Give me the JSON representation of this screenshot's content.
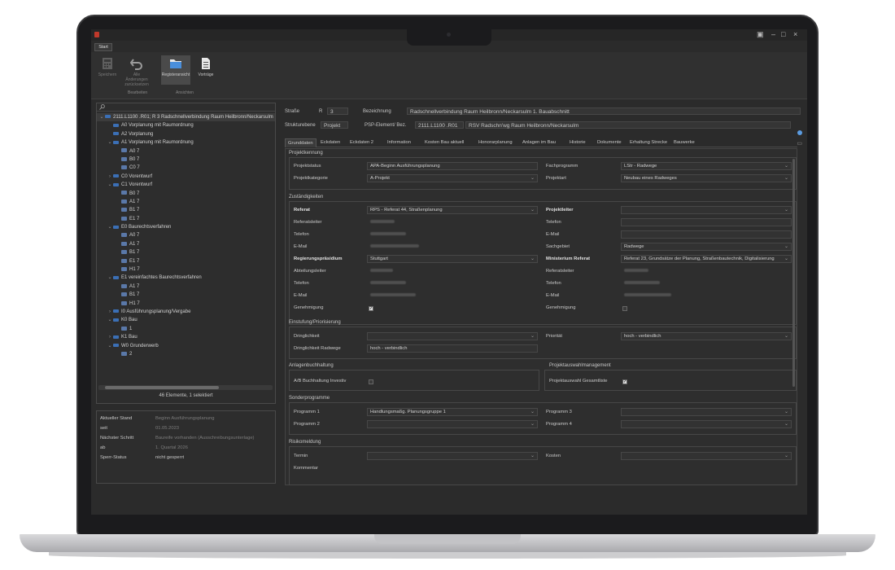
{
  "ribbon": {
    "tab": "Start",
    "buttons": [
      {
        "label": "Speichern",
        "icon": "calculator-icon"
      },
      {
        "label": "Alle Änderungen zurücksetzen",
        "icon": "undo-icon"
      },
      {
        "label": "Registeransicht",
        "icon": "folder-icon"
      },
      {
        "label": "Vorträge",
        "icon": "document-icon"
      }
    ],
    "groups": [
      "Bearbeiten",
      "Ansichten"
    ]
  },
  "tree": {
    "items": [
      {
        "label": "2111.L1100 .R01; R 3 Radschnellverbindung Raum Heilbronn/Neckarsulm",
        "toggle": "⌄",
        "level": 0
      },
      {
        "label": "A0 Vorplanung mit Raumordnung",
        "toggle": "",
        "level": 1
      },
      {
        "label": "A2 Vorplanung",
        "toggle": "",
        "level": 1
      },
      {
        "label": "A1 Vorplanung mit Raumordnung",
        "toggle": "⌄",
        "level": 1
      },
      {
        "label": "A0 7",
        "toggle": "",
        "level": 2
      },
      {
        "label": "B0 7",
        "toggle": "",
        "level": 2
      },
      {
        "label": "C0 7",
        "toggle": "",
        "level": 2
      },
      {
        "label": "C0 Vorentwurf",
        "toggle": "›",
        "level": 1
      },
      {
        "label": "C1 Vorentwurf",
        "toggle": "⌄",
        "level": 1
      },
      {
        "label": "B0 7",
        "toggle": "",
        "level": 2
      },
      {
        "label": "A1 7",
        "toggle": "",
        "level": 2
      },
      {
        "label": "B1 7",
        "toggle": "",
        "level": 2
      },
      {
        "label": "E1 7",
        "toggle": "",
        "level": 2
      },
      {
        "label": "E0 Baurechtsverfahren",
        "toggle": "⌄",
        "level": 1
      },
      {
        "label": "A0 7",
        "toggle": "",
        "level": 2
      },
      {
        "label": "A1 7",
        "toggle": "",
        "level": 2
      },
      {
        "label": "B1 7",
        "toggle": "",
        "level": 2
      },
      {
        "label": "E1 7",
        "toggle": "",
        "level": 2
      },
      {
        "label": "H1 7",
        "toggle": "",
        "level": 2
      },
      {
        "label": "E1 vereinfachtes Baurechtsverfahren",
        "toggle": "⌄",
        "level": 1
      },
      {
        "label": "A1 7",
        "toggle": "",
        "level": 2
      },
      {
        "label": "B1 7",
        "toggle": "",
        "level": 2
      },
      {
        "label": "H1 7",
        "toggle": "",
        "level": 2
      },
      {
        "label": "I0 Ausführungsplanung/Vergabe",
        "toggle": "›",
        "level": 1
      },
      {
        "label": "K0 Bau",
        "toggle": "⌄",
        "level": 1
      },
      {
        "label": "1",
        "toggle": "",
        "level": 2
      },
      {
        "label": "K1 Bau",
        "toggle": "›",
        "level": 1
      },
      {
        "label": "W0 Grunderwerb",
        "toggle": "⌄",
        "level": 1
      },
      {
        "label": "2",
        "toggle": "",
        "level": 2
      }
    ],
    "status": "46 Elemente, 1 selektiert"
  },
  "info": {
    "rows": [
      {
        "key": "Aktueller Stand",
        "value": "Beginn Ausführungsplanung"
      },
      {
        "key": "seit",
        "value": "01.05.2023"
      },
      {
        "key": "Nächster Schritt",
        "value": "Baureife vorhanden (Ausschreibungsunterlage)"
      },
      {
        "key": "ab",
        "value": "1. Quartal 2026"
      },
      {
        "key": "Sperr-Status",
        "value": "nicht gesperrt"
      }
    ]
  },
  "header": {
    "strasse_label": "Straße",
    "strasse_r": "R",
    "strasse_num": "3",
    "bezeichnung_label": "Bezeichnung",
    "bezeichnung_value": "Radschnellverbindung Raum Heilbronn/Neckarsulm 1. Bauabschnitt",
    "strukturebene_label": "Strukturebene",
    "strukturebene_value": "Projekt",
    "psp_label": "PSP-Element/ Bez.",
    "psp_value": "2111.L1100 .R01",
    "psp_desc": "RSV Radschn'wg Raum Heilbronn/Neckarsulm"
  },
  "tabs": [
    "Grunddaten",
    "Eckdaten",
    "Eckdaten 2",
    "Information",
    "Kosten Bau aktuell",
    "Honorarplanung",
    "Anlagen im Bau",
    "Historie",
    "Dokumente",
    "Erhaltung Strecke",
    "Bauwerke"
  ],
  "form": {
    "projektkennung": {
      "title": "Projektkennung",
      "projektstatus_label": "Projektstatus",
      "projektstatus": "APA-Beginn Ausführungsplanung",
      "fachprogramm_label": "Fachprogramm",
      "fachprogramm": "LStr - Radwege",
      "projektkategorie_label": "Projektkategorie",
      "projektkategorie": "A-Projekt",
      "projektart_label": "Projektart",
      "projektart": "Neubau eines Radweges"
    },
    "zustaendigkeiten": {
      "title": "Zuständigkeiten",
      "referat_label": "Referat",
      "referat": "RPS - Referat 44, Straßenplanung",
      "projektleiter_label": "Projektleiter",
      "referatsleiter_label": "Referatsleiter",
      "telefon_label": "Telefon",
      "email_label": "E-Mail",
      "sachgebiet_label": "Sachgebiet",
      "sachgebiet": "Radwege",
      "rp_label": "Regierungspräsidium",
      "rp": "Stuttgart",
      "ministerium_label": "Ministerium Referat",
      "ministerium": "Referat 23, Grundsätze der Planung, Straßenbautechnik, Digitalisierung",
      "abteilungsleiter_label": "Abteilungsleiter",
      "genehmigung_label": "Genehmigung"
    },
    "einstufung": {
      "title": "Einstufung/Priorisierung",
      "dringlichkeit_label": "Dringlichkeit",
      "prioritaet_label": "Priorität",
      "prioritaet": "hoch - verbindlich",
      "dringlichkeit_radwege_label": "Dringlichkeit Radwege",
      "dringlichkeit_radwege": "hoch - verbindlich"
    },
    "anlagen": {
      "title": "Anlagenbuchhaltung",
      "ab_label": "A/B Buchhaltung Investiv"
    },
    "projektauswahl": {
      "title": "Projektauswahlmanagement",
      "label": "Projektauswahl Gesamtliste"
    },
    "sonderprogramme": {
      "title": "Sonderprogramme",
      "p1_label": "Programm 1",
      "p1": "Handlungsmaßg. Planungsgruppe 1",
      "p2_label": "Programm 2",
      "p3_label": "Programm 3",
      "p4_label": "Programm 4"
    },
    "risiko": {
      "title": "Risikomeldung",
      "termin_label": "Termin",
      "kosten_label": "Kosten",
      "kommentar_label": "Kommentar"
    }
  },
  "colors": {
    "accent": "#3b6fb5",
    "background": "#2b2b2b",
    "info_dot": "#5b9be0"
  }
}
